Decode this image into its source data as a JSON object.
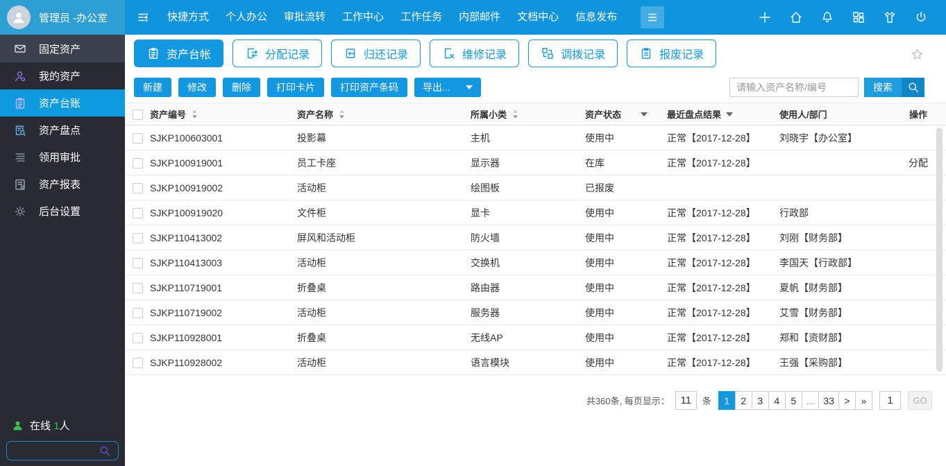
{
  "header": {
    "user_name": "管理员 -办公室",
    "nav_items": [
      "快捷方式",
      "个人办公",
      "审批流转",
      "工作中心",
      "工作任务",
      "内部邮件",
      "文档中心",
      "信息发布"
    ],
    "right_icons": [
      "plus-icon",
      "home-icon",
      "bell-icon",
      "apps-icon",
      "shirt-icon",
      "power-icon"
    ]
  },
  "sidebar": {
    "items": [
      {
        "label": "固定资产",
        "icon": "envelope-icon",
        "active": false
      },
      {
        "label": "我的资产",
        "icon": "user-icon",
        "active": false
      },
      {
        "label": "资产台账",
        "icon": "clipboard-icon",
        "active": true
      },
      {
        "label": "资产盘点",
        "icon": "doc-search-icon",
        "active": false
      },
      {
        "label": "领用审批",
        "icon": "list-lines-icon",
        "active": false
      },
      {
        "label": "资产报表",
        "icon": "report-icon",
        "active": false
      },
      {
        "label": "后台设置",
        "icon": "gear-icon",
        "active": false
      }
    ],
    "online": {
      "prefix": "在线",
      "count": "1",
      "suffix": "人"
    }
  },
  "tabs": [
    {
      "label": "资产台帐",
      "icon": "clipboard-icon",
      "active": true
    },
    {
      "label": "分配记录",
      "icon": "doc-arrows-icon",
      "active": false
    },
    {
      "label": "归还记录",
      "icon": "doc-return-icon",
      "active": false
    },
    {
      "label": "维修记录",
      "icon": "doc-repair-icon",
      "active": false
    },
    {
      "label": "调拨记录",
      "icon": "transfer-icon",
      "active": false
    },
    {
      "label": "报废记录",
      "icon": "scrap-icon",
      "active": false
    }
  ],
  "toolbar": {
    "buttons": [
      "新建",
      "修改",
      "删除",
      "打印卡片",
      "打印资产条码"
    ],
    "export_label": "导出...",
    "search_placeholder": "请输入资产名称/编号",
    "search_label": "搜索"
  },
  "table": {
    "columns": [
      {
        "label": "资产编号",
        "sort": true
      },
      {
        "label": "资产名称",
        "sort": true
      },
      {
        "label": "所属小类",
        "sort": true
      },
      {
        "label": "资产状态",
        "filter": "far"
      },
      {
        "label": "最近盘点结果",
        "filter": "near"
      },
      {
        "label": "使用人/部门"
      },
      {
        "label": "操作"
      }
    ],
    "rows": [
      [
        "SJKP100603001",
        "投影幕",
        "主机",
        "使用中",
        "正常【2017-12-28】",
        "刘晓宇【办公室】",
        ""
      ],
      [
        "SJKP100919001",
        "员工卡座",
        "显示器",
        "在库",
        "正常【2017-12-28】",
        "",
        "分配"
      ],
      [
        "SJKP100919002",
        "活动柜",
        "绘图板",
        "已报废",
        "",
        "",
        ""
      ],
      [
        "SJKP100919020",
        "文件柜",
        "显卡",
        "使用中",
        "正常【2017-12-28】",
        "行政部",
        ""
      ],
      [
        "SJKP110413002",
        "屏风和活动柜",
        "防火墙",
        "使用中",
        "正常【2017-12-28】",
        "刘刚【财务部】",
        ""
      ],
      [
        "SJKP110413003",
        "活动柜",
        "交换机",
        "使用中",
        "正常【2017-12-28】",
        "李国天【行政部】",
        ""
      ],
      [
        "SJKP110719001",
        "折叠桌",
        "路由器",
        "使用中",
        "正常【2017-12-28】",
        "夏帆【财务部】",
        ""
      ],
      [
        "SJKP110719002",
        "活动柜",
        "服务器",
        "使用中",
        "正常【2017-12-28】",
        "艾雪【财务部】",
        ""
      ],
      [
        "SJKP110928001",
        "折叠桌",
        "无线AP",
        "使用中",
        "正常【2017-12-28】",
        "郑和【资财部】",
        ""
      ],
      [
        "SJKP110928002",
        "活动柜",
        "语言模块",
        "使用中",
        "正常【2017-12-28】",
        "王强【采购部】",
        ""
      ]
    ]
  },
  "pagination": {
    "total_text": "共360条, 每页显示：",
    "page_size": "11",
    "unit_label": "条",
    "pages": [
      "1",
      "2",
      "3",
      "4",
      "5",
      "...",
      "33",
      ">",
      "»"
    ],
    "active_page": "1",
    "goto_value": "1",
    "go_label": "GO"
  },
  "colors": {
    "accent": "#1298e0",
    "header_blue": "#1095dd",
    "sidebar_bg": "#282b34",
    "sidebar_active": "#0d9ade",
    "online_green": "#35c24d"
  }
}
